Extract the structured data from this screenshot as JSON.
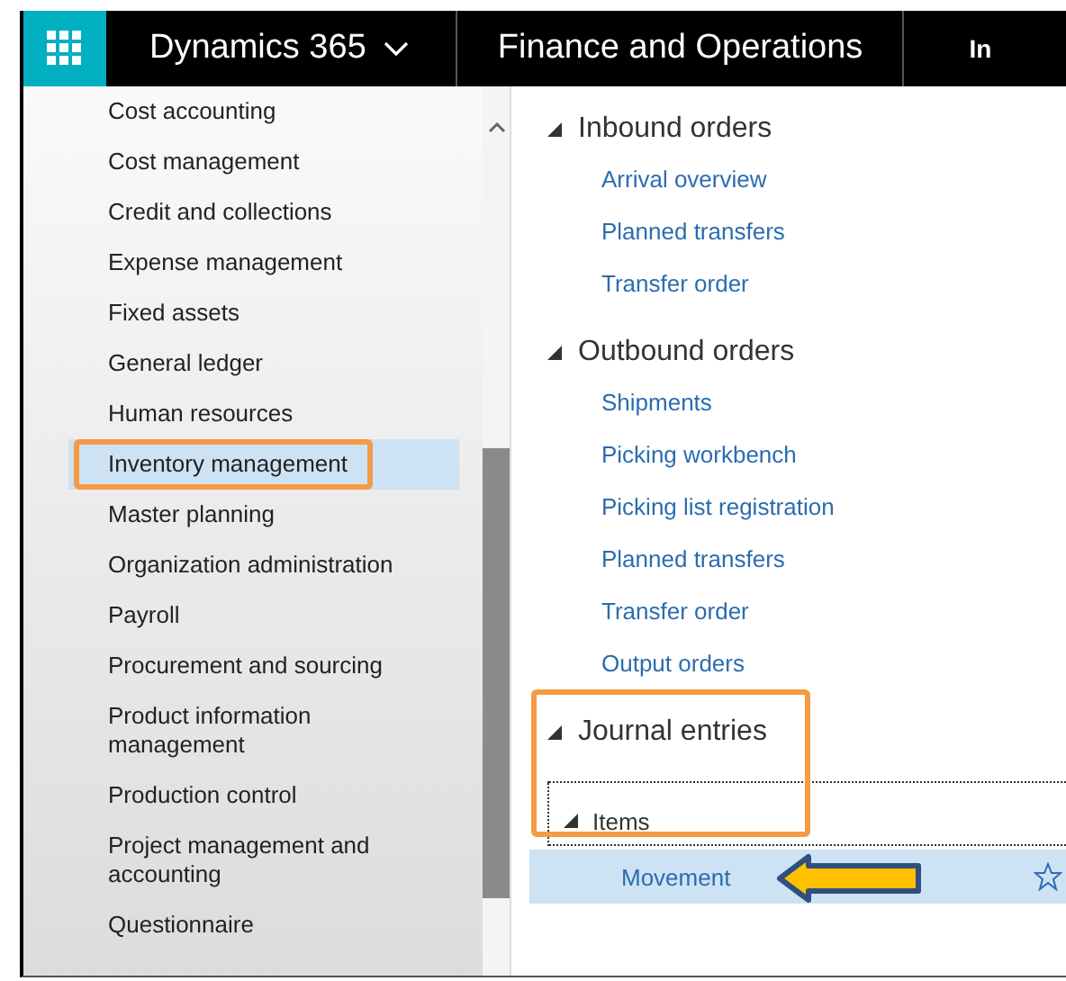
{
  "app_bar": {
    "product": "Dynamics 365",
    "module": "Finance and Operations",
    "next_title": "In"
  },
  "nav": {
    "items": [
      {
        "label": "Cost accounting",
        "selected": false,
        "highlighted": false
      },
      {
        "label": "Cost management",
        "selected": false,
        "highlighted": false
      },
      {
        "label": "Credit and collections",
        "selected": false,
        "highlighted": false
      },
      {
        "label": "Expense management",
        "selected": false,
        "highlighted": false
      },
      {
        "label": "Fixed assets",
        "selected": false,
        "highlighted": false
      },
      {
        "label": "General ledger",
        "selected": false,
        "highlighted": false
      },
      {
        "label": "Human resources",
        "selected": false,
        "highlighted": false
      },
      {
        "label": "Inventory management",
        "selected": true,
        "highlighted": true
      },
      {
        "label": "Master planning",
        "selected": false,
        "highlighted": false
      },
      {
        "label": "Organization administration",
        "selected": false,
        "highlighted": false
      },
      {
        "label": "Payroll",
        "selected": false,
        "highlighted": false
      },
      {
        "label": "Procurement and sourcing",
        "selected": false,
        "highlighted": false
      },
      {
        "label": "Product information management",
        "selected": false,
        "highlighted": false
      },
      {
        "label": "Production control",
        "selected": false,
        "highlighted": false
      },
      {
        "label": "Project management and accounting",
        "selected": false,
        "highlighted": false
      },
      {
        "label": "Questionnaire",
        "selected": false,
        "highlighted": false
      }
    ]
  },
  "sections": [
    {
      "title": "Inbound orders",
      "expanded": true,
      "highlighted": false,
      "links": [
        {
          "label": "Arrival overview"
        },
        {
          "label": "Planned transfers"
        },
        {
          "label": "Transfer order"
        }
      ]
    },
    {
      "title": "Outbound orders",
      "expanded": true,
      "highlighted": false,
      "links": [
        {
          "label": "Shipments"
        },
        {
          "label": "Picking workbench"
        },
        {
          "label": "Picking list registration"
        },
        {
          "label": "Planned transfers"
        },
        {
          "label": "Transfer order"
        },
        {
          "label": "Output orders"
        }
      ]
    },
    {
      "title": "Journal entries",
      "expanded": true,
      "highlighted": true,
      "groups": [
        {
          "title": "Items",
          "expanded": true,
          "items": [
            {
              "label": "Movement",
              "selected": true,
              "pointed": true
            }
          ]
        }
      ]
    }
  ]
}
